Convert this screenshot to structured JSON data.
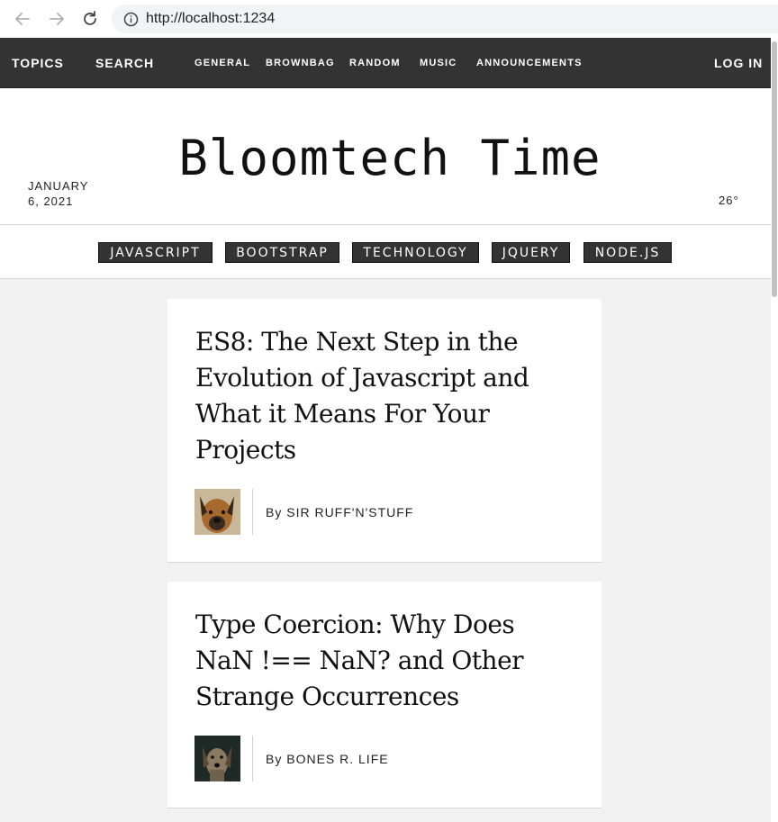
{
  "browser": {
    "url": "http://localhost:1234"
  },
  "topbar": {
    "topics": "TOPICS",
    "search": "SEARCH",
    "nav": [
      "GENERAL",
      "BROWNBAG",
      "RANDOM",
      "MUSIC",
      "ANNOUNCEMENTS"
    ],
    "login": "LOG IN"
  },
  "masthead": {
    "title": "Bloomtech Time",
    "date": "JANUARY 6, 2021",
    "temperature": "26°"
  },
  "tags": [
    "JAVASCRIPT",
    "BOOTSTRAP",
    "TECHNOLOGY",
    "JQUERY",
    "NODE.JS"
  ],
  "articles": [
    {
      "headline": "ES8: The Next Step in the Evolution of Javascript and What it Means For Your Projects",
      "author": "By SIR RUFF'N'STUFF"
    },
    {
      "headline": "Type Coercion: Why Does NaN !== NaN? and Other Strange Occurrences",
      "author": "By BONES R. LIFE"
    }
  ],
  "colors": {
    "topbar": "#333333",
    "page_bg": "#f1f1f1",
    "card_bg": "#ffffff"
  }
}
